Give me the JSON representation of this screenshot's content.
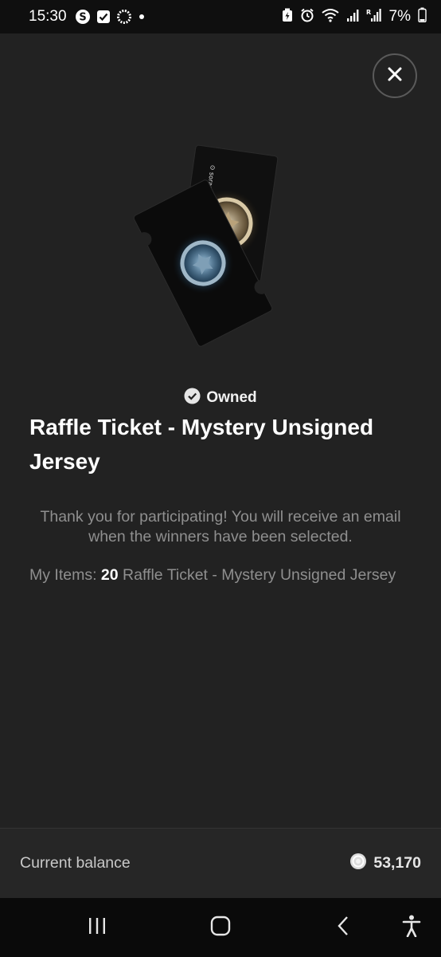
{
  "status_bar": {
    "time": "15:30",
    "battery_percent": "7%",
    "icons": [
      "s-icon",
      "check-box-icon",
      "loading-circle-icon",
      "dot-icon",
      "battery-saver-icon",
      "alarm-icon",
      "wifi-icon",
      "signal-icon",
      "signal-r-icon",
      "battery-icon"
    ]
  },
  "close_icon": "close-icon",
  "badge": {
    "label": "Owned",
    "icon": "check-circle-icon"
  },
  "item": {
    "title": "Raffle Ticket - Mystery Unsigned Jersey"
  },
  "thanks": {
    "text": "Thank you for participating! You will receive an email when the winners have been selected."
  },
  "my_items": {
    "prefix": "My Items: ",
    "count": "20",
    "name": " Raffle Ticket - Mystery Unsigned Jersey"
  },
  "balance": {
    "label": "Current balance",
    "amount": "53,170",
    "icon": "coin-icon"
  },
  "colors": {
    "background": "#222222",
    "muted_text": "#8f8f8f",
    "nav": "#0a0a0a"
  },
  "nav": [
    "recent-apps-icon",
    "home-icon",
    "back-icon",
    "accessibility-icon"
  ]
}
